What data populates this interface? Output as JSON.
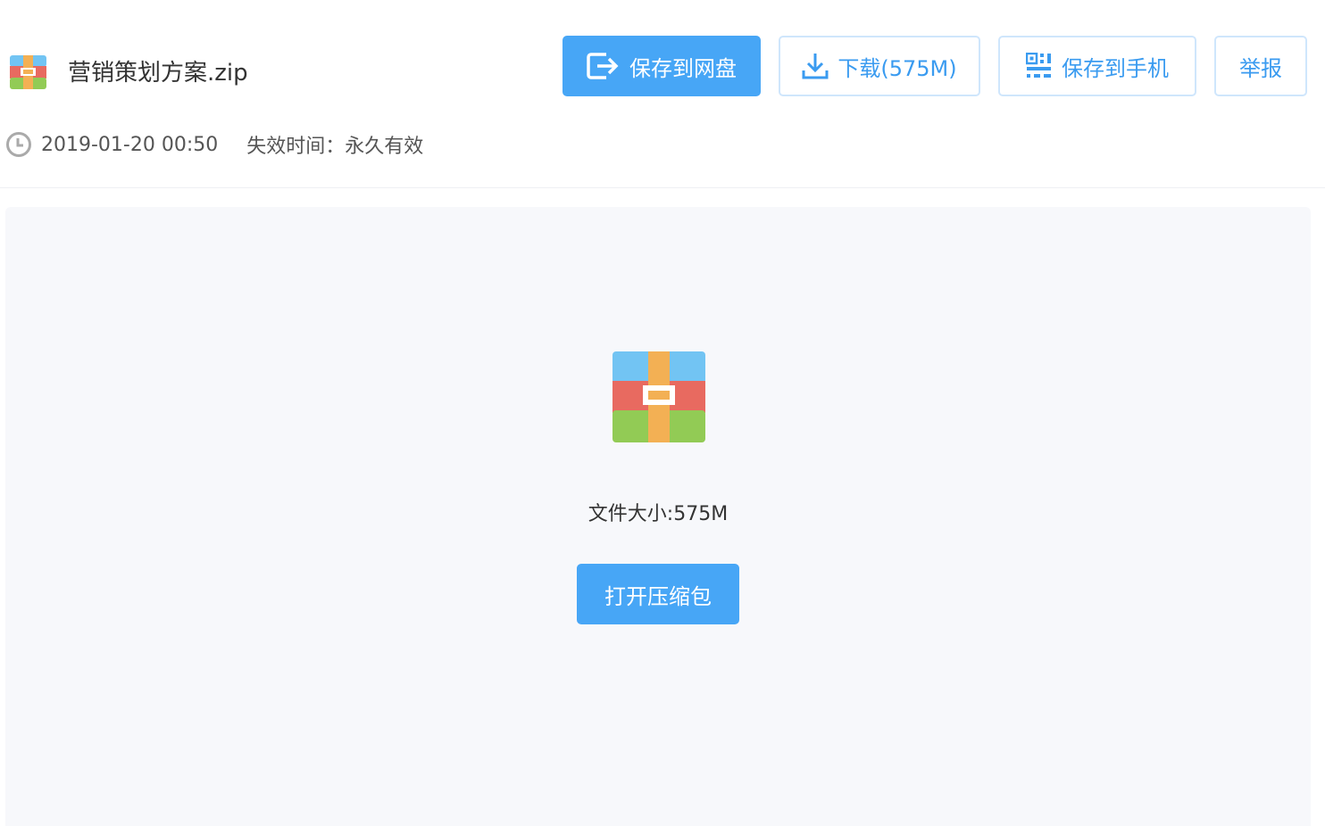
{
  "file": {
    "name": "营销策划方案.zip",
    "icon": "zip-archive-icon"
  },
  "actions": {
    "save_to_disk": "保存到网盘",
    "download": "下载(575M)",
    "save_to_phone": "保存到手机",
    "report": "举报"
  },
  "meta": {
    "date": "2019-01-20 00:50",
    "expiry": "失效时间：永久有效"
  },
  "preview": {
    "size_label": "文件大小:575M",
    "open_button": "打开压缩包"
  },
  "colors": {
    "primary": "#47a6f6",
    "outline_border": "#cfe6fc",
    "panel_bg": "#f7f8fb"
  }
}
